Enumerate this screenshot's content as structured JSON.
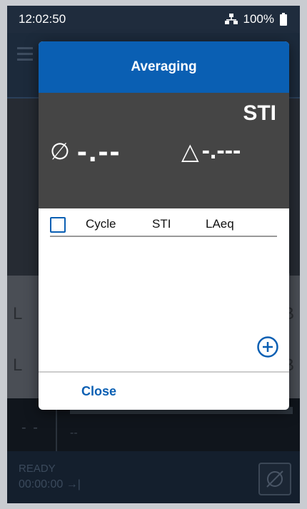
{
  "status": {
    "time": "12:02:50",
    "battery": "100%"
  },
  "background": {
    "row1_left": "L",
    "row1_right": "B",
    "row2_left": "L",
    "row2_right": "B",
    "lower_dash": "- -",
    "lower_small": "--",
    "ready": "READY",
    "timer": "00:00:00 →|"
  },
  "modal": {
    "title": "Averaging",
    "metric": "STI",
    "avg_symbol": "∅",
    "avg_value": "-.--",
    "delta_symbol": "△",
    "delta_value": "-.---",
    "columns": {
      "cycle": "Cycle",
      "sti": "STI",
      "laeq": "LAeq"
    },
    "close_label": "Close"
  },
  "colors": {
    "accent": "#0a5fb3",
    "panel": "#454545"
  }
}
